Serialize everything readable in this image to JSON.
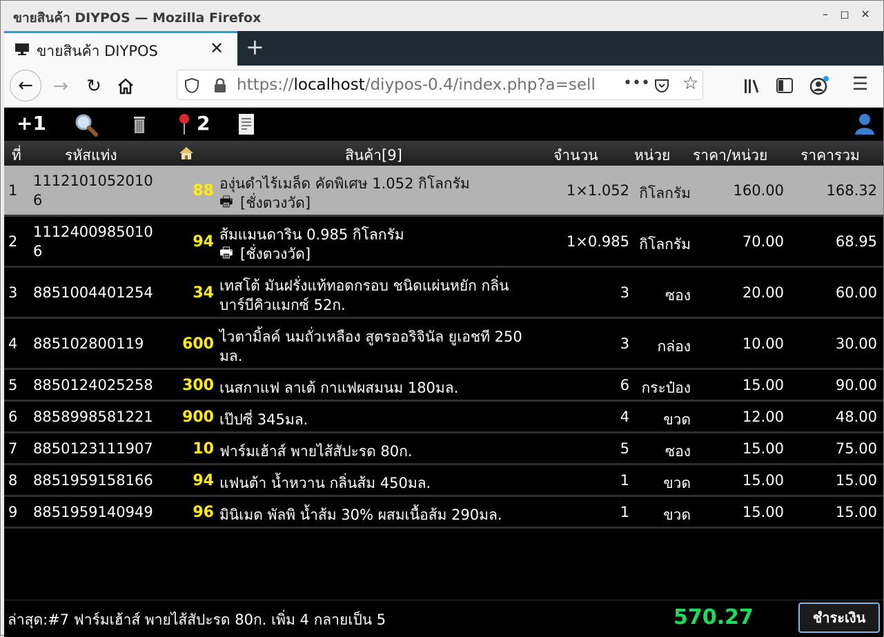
{
  "window": {
    "title": "ขายสินค้า DIYPOS — Mozilla Firefox"
  },
  "tab": {
    "label": "ขายสินค้า DIYPOS"
  },
  "url": {
    "scheme": "https://",
    "host": "localhost",
    "path": "/diypos-0.4/index.php?a=sell"
  },
  "toolbar": {
    "plus_one": "+1",
    "pin_count": "2"
  },
  "table": {
    "headers": {
      "no": "ที่",
      "barcode": "รหัสแท่ง",
      "product": "สินค้า[9]",
      "qty": "จำนวน",
      "unit": "หน่วย",
      "price": "ราคา/หน่วย",
      "total": "ราคารวม"
    },
    "rows": [
      {
        "no": "1",
        "barcode1": "1112101052010",
        "barcode2": "6",
        "stock": "88",
        "name1": "องุ่นดำไร้เมล็ด คัดพิเศษ 1.052 กิโลกรัม",
        "name2": "[ชั่งตวงวัด]",
        "qty": "1×1.052",
        "unit": "กิโลกรัม",
        "price": "160.00",
        "total": "168.32"
      },
      {
        "no": "2",
        "barcode1": "1112400985010",
        "barcode2": "6",
        "stock": "94",
        "name1": "ส้มแมนดาริน 0.985 กิโลกรัม",
        "name2": "[ชั่งตวงวัด]",
        "qty": "1×0.985",
        "unit": "กิโลกรัม",
        "price": "70.00",
        "total": "68.95"
      },
      {
        "no": "3",
        "barcode1": "8851004401254",
        "barcode2": "",
        "stock": "34",
        "name1": "เทสโต้ มันฝรั่งแท้ทอดกรอบ ชนิดแผ่นหยัก กลิ่น",
        "name2": "บาร์บีคิวแมกซ์ 52ก.",
        "qty": "3",
        "unit": "ซอง",
        "price": "20.00",
        "total": "60.00"
      },
      {
        "no": "4",
        "barcode1": "885102800119",
        "barcode2": "",
        "stock": "600",
        "name1": "ไวตามิ้ลค์ นมถั่วเหลือง สูตรออริจินัล ยูเอชที 250",
        "name2": "มล.",
        "qty": "3",
        "unit": "กล่อง",
        "price": "10.00",
        "total": "30.00"
      },
      {
        "no": "5",
        "barcode1": "8850124025258",
        "barcode2": "",
        "stock": "300",
        "name1": "เนสกาแฟ ลาเต้ กาแฟผสมนม 180มล.",
        "name2": "",
        "qty": "6",
        "unit": "กระป๋อง",
        "price": "15.00",
        "total": "90.00"
      },
      {
        "no": "6",
        "barcode1": "8858998581221",
        "barcode2": "",
        "stock": "900",
        "name1": "เป๊ปซี่ 345มล.",
        "name2": "",
        "qty": "4",
        "unit": "ขวด",
        "price": "12.00",
        "total": "48.00"
      },
      {
        "no": "7",
        "barcode1": "8850123111907",
        "barcode2": "",
        "stock": "10",
        "name1": "ฟาร์มเฮ้าส์ พายไส้สัปะรด 80ก.",
        "name2": "",
        "qty": "5",
        "unit": "ซอง",
        "price": "15.00",
        "total": "75.00"
      },
      {
        "no": "8",
        "barcode1": "8851959158166",
        "barcode2": "",
        "stock": "94",
        "name1": "แฟนต้า น้ำหวาน กลิ่นส้ม 450มล.",
        "name2": "",
        "qty": "1",
        "unit": "ขวด",
        "price": "15.00",
        "total": "15.00"
      },
      {
        "no": "9",
        "barcode1": "8851959140949",
        "barcode2": "",
        "stock": "96",
        "name1": "มินิเมด พัลพิ น้ำส้ม 30% ผสมเนื้อส้ม 290มล.",
        "name2": "",
        "qty": "1",
        "unit": "ขวด",
        "price": "15.00",
        "total": "15.00"
      }
    ]
  },
  "footer": {
    "last": "ล่าสุด:#7 ฟาร์มเฮ้าส์ พายไส้สัปะรด 80ก. เพิ่ม 4 กลายเป็น 5",
    "total": "570.27",
    "pay_label": "ชำระเงิน"
  },
  "colors": {
    "accent": "#1e9fd8",
    "stock": "#ffee00",
    "total": "#16e05a",
    "selected_row": "#b3b3b3"
  }
}
